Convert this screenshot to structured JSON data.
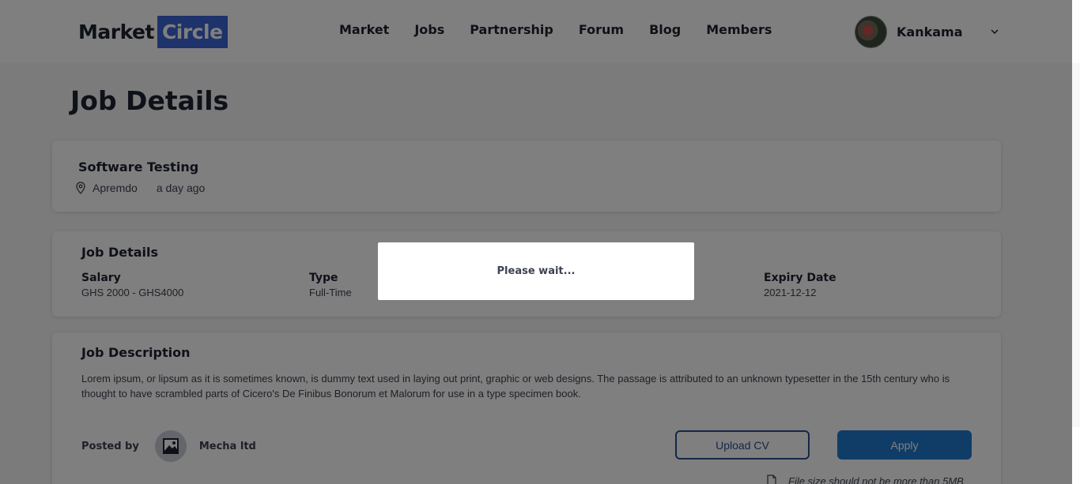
{
  "brand": {
    "left": "Market",
    "right": "Circle",
    "accent": "#3d64d6"
  },
  "nav": [
    "Market",
    "Jobs",
    "Partnership",
    "Forum",
    "Blog",
    "Members"
  ],
  "user": {
    "name": "Kankama"
  },
  "page_title": "Job Details",
  "job": {
    "title": "Software Testing",
    "location": "Apremdo",
    "posted_ago": "a day ago"
  },
  "details": {
    "section_title": "Job Details",
    "salary_label": "Salary",
    "salary_value": "GHS 2000 - GHS4000",
    "type_label": "Type",
    "type_value": "Full-Time",
    "expiry_label": "Expiry Date",
    "expiry_value": "2021-12-12"
  },
  "description": {
    "section_title": "Job Description",
    "text": "Lorem ipsum, or lipsum as it is sometimes known, is dummy text used in laying out print, graphic or web designs. The passage is attributed to an unknown typesetter in the 15th century who is thought to have scrambled parts of Cicero's De Finibus Bonorum et Malorum for use in a type specimen book."
  },
  "posted_by": {
    "label": "Posted by",
    "company": "Mecha ltd"
  },
  "actions": {
    "upload": "Upload CV",
    "apply": "Apply"
  },
  "file_note": "File size should not be more than 5MB",
  "modal": {
    "message": "Please wait..."
  },
  "icons": {
    "location": "location-pin-icon",
    "chevron": "chevron-down-icon",
    "image": "image-placeholder-icon",
    "file": "file-icon"
  }
}
